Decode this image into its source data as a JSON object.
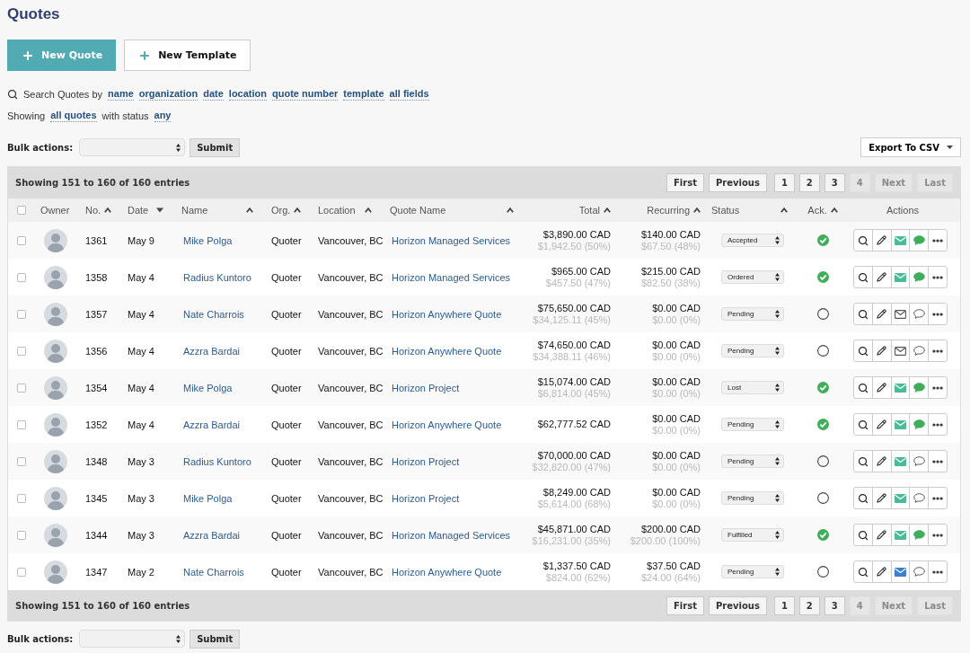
{
  "page_title": "Quotes",
  "buttons": [
    {
      "label": "New Quote",
      "kind": "primary"
    },
    {
      "label": "New Template",
      "kind": "secondary"
    }
  ],
  "search": {
    "label": "Search Quotes by",
    "filters": [
      "name",
      "organization",
      "date",
      "location",
      "quote number",
      "template",
      "all fields"
    ]
  },
  "showing": {
    "prefix": "Showing",
    "scope": "all quotes",
    "middle": "with status",
    "status": "any"
  },
  "bulk_actions_top": {
    "label": "Bulk actions:",
    "button": "Submit"
  },
  "export_button": "Export To CSV",
  "table": {
    "info_top": "Showing 151 to 160 of 160 entries",
    "pager_top": [
      {
        "label": "First",
        "disabled": false
      },
      {
        "label": "Previous",
        "disabled": false
      },
      {
        "label": "1",
        "disabled": false
      },
      {
        "label": "2",
        "disabled": false
      },
      {
        "label": "3",
        "disabled": false
      },
      {
        "label": "4",
        "disabled": true
      },
      {
        "label": "Next",
        "disabled": true
      },
      {
        "label": "Last",
        "disabled": true
      }
    ],
    "select_all": {
      "checked": false
    },
    "columns": [
      {
        "label": "Owner"
      },
      {
        "label": "No.",
        "descending": false
      },
      {
        "label": "Date",
        "descending": true
      },
      {
        "label": "Name",
        "descending": false
      },
      {
        "label": "Org.",
        "descending": false
      },
      {
        "label": "Location",
        "descending": false
      },
      {
        "label": "Quote Name",
        "descending": false
      },
      {
        "label": "Total",
        "descending": false
      },
      {
        "label": "Recurring",
        "descending": false
      },
      {
        "label": "Status",
        "descending": false
      },
      {
        "label": "Ack.",
        "descending": false
      },
      {
        "label": "Actions"
      }
    ],
    "rows": [
      {
        "checked": false,
        "number": "1361",
        "date": "May 9",
        "name": "Mike Polga",
        "org": "Quoter",
        "location": "Vancouver, BC",
        "quote_name": "Horizon Managed Services",
        "total": "$3,890.00 CAD",
        "total_sub": "$1,942.50 (50%)",
        "recurring": "$140.00 CAD",
        "recurring_sub": "$67.50 (48%)",
        "status": "Accepted",
        "acknowledged": true,
        "email_sent": true,
        "email_opened": false,
        "comment": true
      },
      {
        "checked": false,
        "number": "1358",
        "date": "May 4",
        "name": "Radius Kuntoro",
        "org": "Quoter",
        "location": "Vancouver, BC",
        "quote_name": "Horizon Managed Services",
        "total": "$965.00 CAD",
        "total_sub": "$457.50 (47%)",
        "recurring": "$215.00 CAD",
        "recurring_sub": "$82.50 (38%)",
        "status": "Ordered",
        "acknowledged": true,
        "email_sent": true,
        "email_opened": false,
        "comment": true
      },
      {
        "checked": false,
        "number": "1357",
        "date": "May 4",
        "name": "Nate Charrois",
        "org": "Quoter",
        "location": "Vancouver, BC",
        "quote_name": "Horizon Anywhere Quote",
        "total": "$75,650.00 CAD",
        "total_sub": "$34,125.11 (45%)",
        "recurring": "$0.00 CAD",
        "recurring_sub": "$0.00 (0%)",
        "status": "Pending",
        "acknowledged": false,
        "email_sent": false,
        "comment": false
      },
      {
        "checked": false,
        "number": "1356",
        "date": "May 4",
        "name": "Azzra Bardai",
        "org": "Quoter",
        "location": "Vancouver, BC",
        "quote_name": "Horizon Anywhere Quote",
        "total": "$74,650.00 CAD",
        "total_sub": "$34,388.11 (46%)",
        "recurring": "$0.00 CAD",
        "recurring_sub": "$0.00 (0%)",
        "status": "Pending",
        "acknowledged": false,
        "email_sent": false,
        "comment": false
      },
      {
        "checked": false,
        "number": "1354",
        "date": "May 4",
        "name": "Mike Polga",
        "org": "Quoter",
        "location": "Vancouver, BC",
        "quote_name": "Horizon Project",
        "total": "$15,074.00 CAD",
        "total_sub": "$6,814.00 (45%)",
        "recurring": "$0.00 CAD",
        "recurring_sub": "$0.00 (0%)",
        "status": "Lost",
        "acknowledged": true,
        "email_sent": true,
        "email_opened": false,
        "comment": true
      },
      {
        "checked": false,
        "number": "1352",
        "date": "May 4",
        "name": "Azzra Bardai",
        "org": "Quoter",
        "location": "Vancouver, BC",
        "quote_name": "Horizon Anywhere Quote",
        "total": "$62,777.52 CAD",
        "recurring": "$0.00 CAD",
        "recurring_sub": "$0.00 (0%)",
        "status": "Pending",
        "acknowledged": true,
        "email_sent": true,
        "email_opened": false,
        "comment": true
      },
      {
        "checked": false,
        "number": "1348",
        "date": "May 3",
        "name": "Radius Kuntoro",
        "org": "Quoter",
        "location": "Vancouver, BC",
        "quote_name": "Horizon Project",
        "total": "$70,000.00 CAD",
        "total_sub": "$32,820.00 (47%)",
        "recurring": "$0.00 CAD",
        "recurring_sub": "$0.00 (0%)",
        "status": "Pending",
        "acknowledged": false,
        "email_sent": true,
        "email_opened": false,
        "comment": false
      },
      {
        "checked": false,
        "number": "1345",
        "date": "May 3",
        "name": "Mike Polga",
        "org": "Quoter",
        "location": "Vancouver, BC",
        "quote_name": "Horizon Project",
        "total": "$8,249.00 CAD",
        "total_sub": "$5,614.00 (68%)",
        "recurring": "$0.00 CAD",
        "recurring_sub": "$0.00 (0%)",
        "status": "Pending",
        "acknowledged": false,
        "email_sent": true,
        "email_opened": false,
        "comment": false
      },
      {
        "checked": false,
        "number": "1344",
        "date": "May 3",
        "name": "Azzra Bardai",
        "org": "Quoter",
        "location": "Vancouver, BC",
        "quote_name": "Horizon Managed Services",
        "total": "$45,871.00 CAD",
        "total_sub": "$16,231.00 (35%)",
        "recurring": "$200.00 CAD",
        "recurring_sub": "$200.00 (100%)",
        "status": "Fulfilled",
        "acknowledged": true,
        "email_sent": true,
        "email_opened": false,
        "comment": true
      },
      {
        "checked": false,
        "number": "1347",
        "date": "May 2",
        "name": "Nate Charrois",
        "org": "Quoter",
        "location": "Vancouver, BC",
        "quote_name": "Horizon Anywhere Quote",
        "total": "$1,337.50 CAD",
        "total_sub": "$824.00 (62%)",
        "recurring": "$37.50 CAD",
        "recurring_sub": "$24.00 (64%)",
        "status": "Pending",
        "acknowledged": false,
        "email_sent": true,
        "email_opened": true,
        "comment": false
      }
    ],
    "info_bottom": "Showing 151 to 160 of 160 entries",
    "pager_bottom": [
      {
        "label": "First",
        "disabled": false
      },
      {
        "label": "Previous",
        "disabled": false
      },
      {
        "label": "1",
        "disabled": false
      },
      {
        "label": "2",
        "disabled": false
      },
      {
        "label": "3",
        "disabled": false
      },
      {
        "label": "4",
        "disabled": true
      },
      {
        "label": "Next",
        "disabled": true
      },
      {
        "label": "Last",
        "disabled": true
      }
    ]
  },
  "bulk_actions_bottom": {
    "label": "Bulk actions:",
    "button": "Submit"
  }
}
